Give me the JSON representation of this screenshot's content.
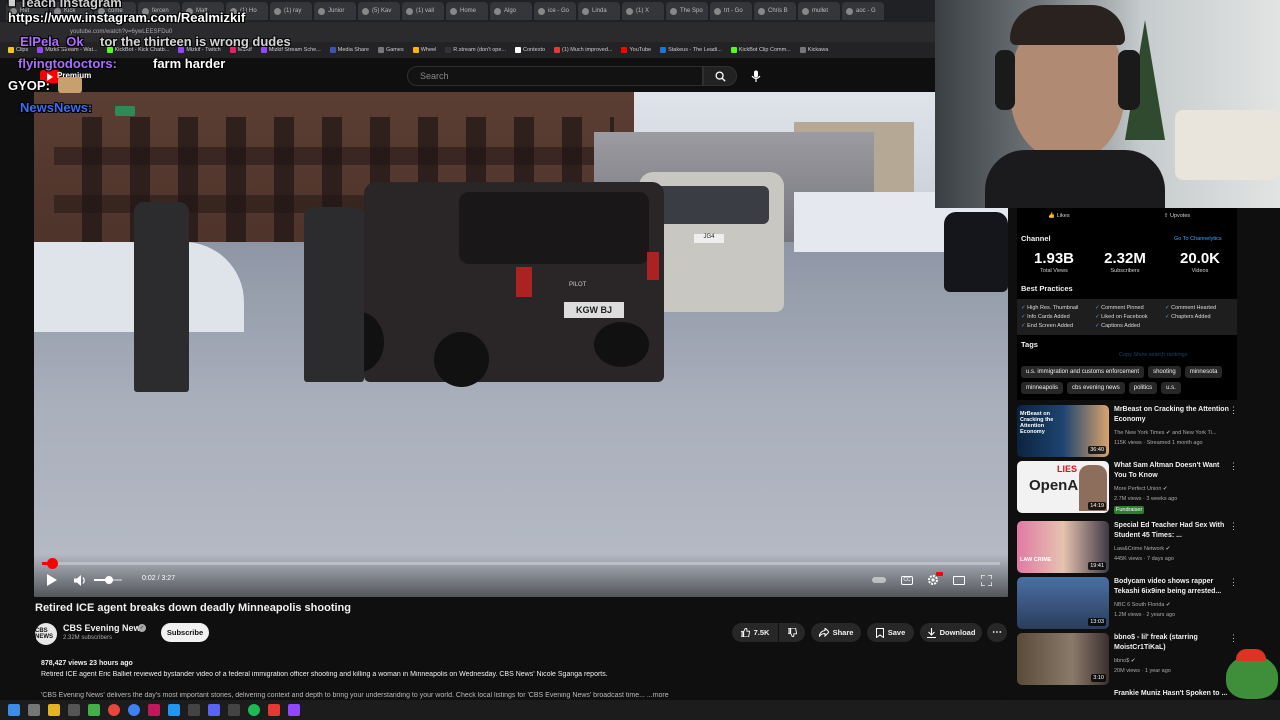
{
  "browser": {
    "tabs": [
      "Ret",
      "Kick",
      "come",
      "fercen",
      "Matt",
      "(1) Ho",
      "(1) ray",
      "Junior",
      "(5) Kav",
      "(1) vall",
      "Home",
      "Algo",
      "ice - Go",
      "Linda",
      "(1) X",
      "The Spo",
      "trt - Go",
      "Chris B",
      "mullet",
      "aoc - G"
    ],
    "url": "youtube.com/watch?v=6ywLEESFDu0",
    "bookmarks": [
      "Clips",
      "Mizkif Stream - Wat...",
      "KickBot - Kick Chatb...",
      "Mizkif - Twitch",
      "Mizkif",
      "Mizkif Stream Sche...",
      "Media Share",
      "Games",
      "Wheel",
      "R.stream (don't ope...",
      "Contexto",
      "(1) Much improved...",
      "YouTube",
      "Stakeus - The Leadi...",
      "KickBot Clip Comm...",
      "Kickawa"
    ]
  },
  "overlay": {
    "line1_partial": "                         ■ Teach Instagram",
    "line2": "https://www.instagram.com/Realmizkif",
    "line3_user": "ElPela_Ok",
    "line3_msg": "tor the thirteen is wrong dudes",
    "line4_user": "flyingtodoctors:",
    "line4_msg": "farm harder",
    "line5": "GYOP:",
    "line6_user": "NewsNews:"
  },
  "youtube": {
    "premium_label": "Premium",
    "search_placeholder": "Search"
  },
  "video": {
    "time_current": "0:02",
    "time_total": "3:27",
    "time_display": "0:02 / 3:27",
    "progress_fraction": 0.01,
    "volume_fraction": 0.55,
    "plate_front": "KGW BJ",
    "plate_back": "JG4",
    "car_model": "PILOT"
  },
  "title": "Retired ICE agent breaks down deadly Minneapolis shooting",
  "channel": {
    "name": "CBS Evening News",
    "subs": "2.32M subscribers",
    "avatar_text": "CBS NEWS",
    "subscribe_label": "Subscribe"
  },
  "actions": {
    "likes": "7.5K",
    "share": "Share",
    "save": "Save",
    "download": "Download"
  },
  "description": {
    "meta": "878,427 views  23 hours ago",
    "text": "Retired ICE agent Eric Balliet reviewed bystander video of a federal immigration officer shooting and killing a woman in Minneapolis on Wednesday. CBS News' Nicole Sganga reports.",
    "more_line": "'CBS Evening News' delivers the day's most important stories, delivering context and depth to bring your understanding to your world. Check local listings for 'CBS Evening News' broadcast time... ...more"
  },
  "stats_panel": {
    "likes_label": "Likes",
    "upvotes_label": "Upvotes",
    "channel_heading": "Channel",
    "channel_link": "Go To Channelytics",
    "total_views": "1.93B",
    "total_views_label": "Total Views",
    "subscribers": "2.32M",
    "subscribers_label": "Subscribers",
    "videos": "20.0K",
    "videos_label": "Videos",
    "best_practices_heading": "Best Practices",
    "best_practices": [
      "High Res. Thumbnail",
      "Comment Pinned",
      "Comment Hearted",
      "Info Cards Added",
      "Liked on Facebook",
      "Chapters Added",
      "End Screen Added",
      "Captions Added"
    ],
    "tags_heading": "Tags",
    "tags_actions": "Copy     Show search rankings",
    "tags": [
      "u.s. immigration and customs enforcement",
      "shooting",
      "minnesota",
      "minneapolis",
      "cbs evening news",
      "politics",
      "u.s."
    ]
  },
  "recommendations": [
    {
      "title": "MrBeast on Cracking the Attention Economy",
      "channel": "The New York Times ✔ and New York Ti...",
      "meta": "115K views · Streamed 1 month ago",
      "duration": "36:40",
      "thumb_text": "MrBeast on Cracking the Attention Economy"
    },
    {
      "title": "What Sam Altman Doesn't Want You To Know",
      "channel": "More Perfect Union ✔",
      "meta": "2.7M views · 3 weeks ago",
      "badge": "Fundraiser",
      "duration": "14:19",
      "thumb_text": "OpenAI",
      "thumb_text2": "LIES"
    },
    {
      "title": "Special Ed Teacher Had Sex With Student 45 Times: ...",
      "channel": "Law&Crime Network ✔",
      "meta": "445K views · 7 days ago",
      "duration": "19:41",
      "thumb_text": "LAW CRIME"
    },
    {
      "title": "Bodycam video shows rapper Tekashi 6ix9ine being arrested...",
      "channel": "NBC 6 South Florida ✔",
      "meta": "1.2M views · 2 years ago",
      "duration": "13:03",
      "thumb_text": ""
    },
    {
      "title": "bbno$ - lil' freak (starring MoistCr1TiKaL)",
      "channel": "bbno$ ✔",
      "meta": "20M views · 1 year ago",
      "duration": "3:10",
      "thumb_text": ""
    },
    {
      "title": "Frankie Muniz Hasn't Spoken to ...",
      "channel": "",
      "meta": "",
      "duration": "",
      "thumb_text": ""
    }
  ],
  "colors": {
    "youtube_red": "#ff0000",
    "accent_blue": "#3ea6ff",
    "background": "#0f0f0f"
  }
}
